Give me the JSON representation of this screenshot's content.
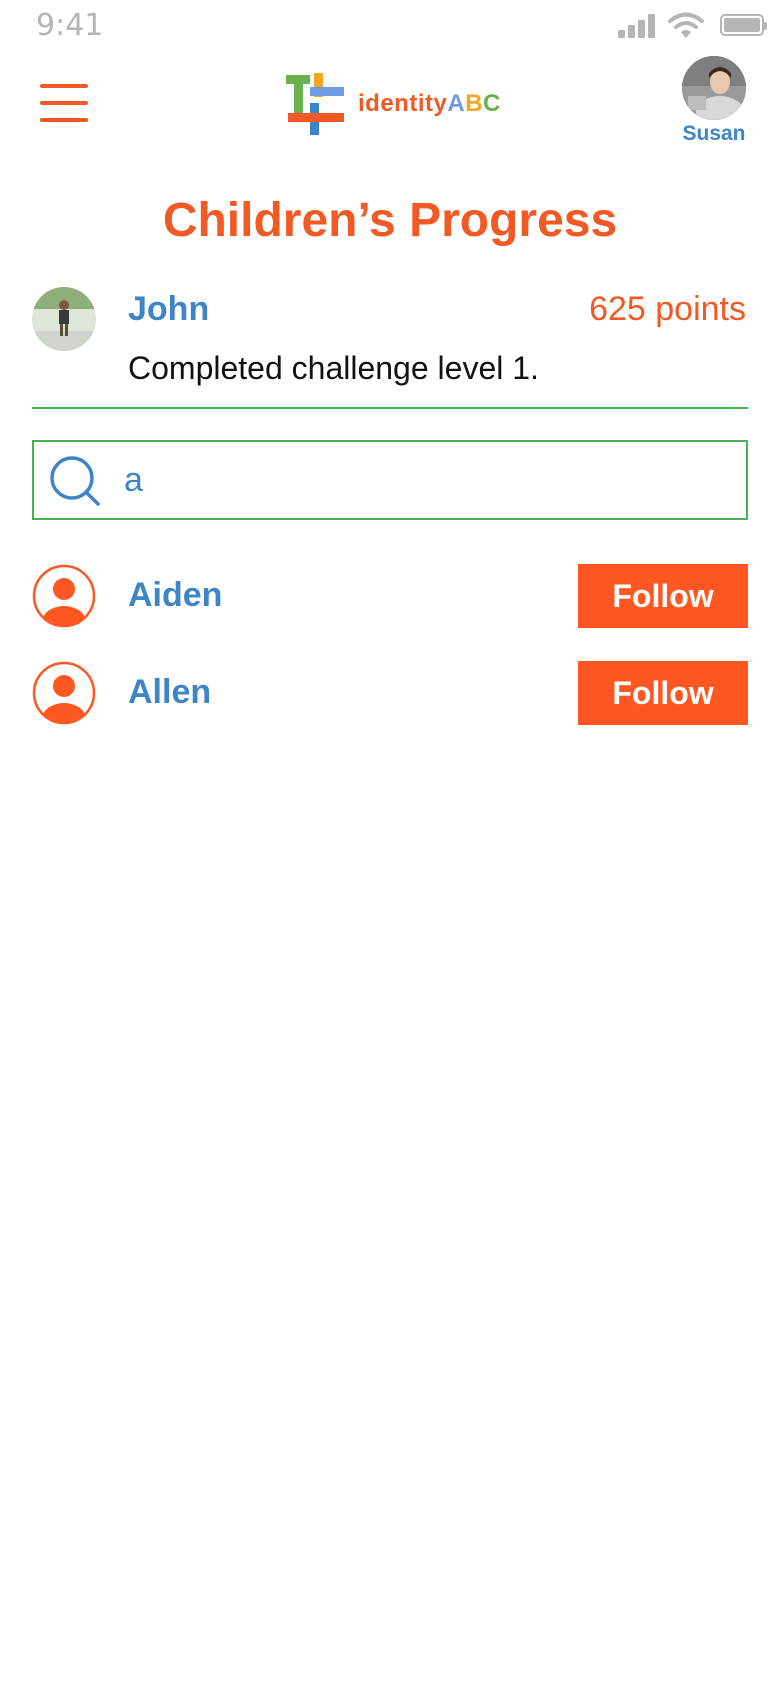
{
  "status_bar": {
    "time": "9:41"
  },
  "header": {
    "menu_icon": "hamburger-menu-icon",
    "logo": {
      "text_main": "identity",
      "text_a": "A",
      "text_b": "B",
      "text_c": "C"
    },
    "user": {
      "name": "Susan"
    }
  },
  "page": {
    "title": "Children’s Progress"
  },
  "child": {
    "name": "John",
    "points": "625 points",
    "status": "Completed challenge level 1."
  },
  "search": {
    "value": "a",
    "icon": "search-icon"
  },
  "results": [
    {
      "name": "Aiden",
      "action": "Follow"
    },
    {
      "name": "Allen",
      "action": "Follow"
    }
  ],
  "colors": {
    "accent": "#f15a24",
    "button": "#ff5722",
    "link": "#3d85c6",
    "divider": "#4caf50"
  }
}
